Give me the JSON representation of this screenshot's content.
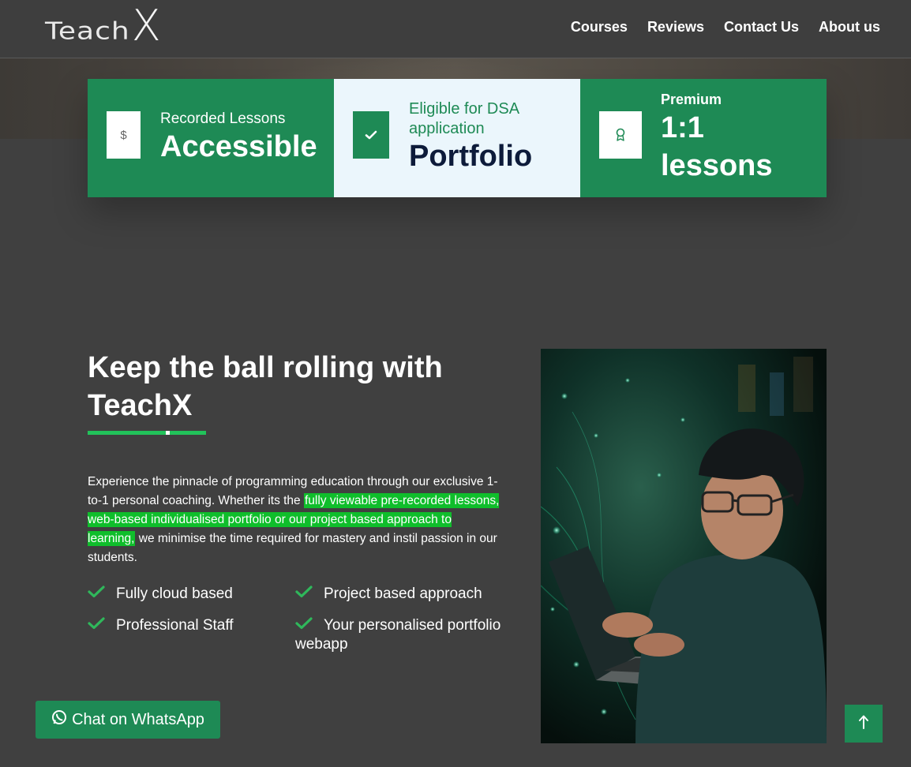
{
  "header": {
    "logo_teach": "Teach",
    "logo_x": "X",
    "nav": [
      "Courses",
      "Reviews",
      "Contact Us",
      "About us"
    ]
  },
  "cards": [
    {
      "small": "Recorded Lessons",
      "big": "Accessible",
      "icon": "dollar-icon",
      "icon_glyph": "$"
    },
    {
      "small": "Eligible for DSA application",
      "big": "Portfolio",
      "icon": "check-icon"
    },
    {
      "small": "Premium",
      "big": "1:1 lessons",
      "icon": "award-icon"
    }
  ],
  "main": {
    "headline": "Keep the ball rolling with TeachX",
    "intro_before": "Experience the pinnacle of programming education through our exclusive 1-to-1 personal coaching. Whether its the ",
    "intro_highlight": "fully viewable pre-recorded lessons, web-based individualised portfolio or our project based approach to learning,",
    "intro_after": " we minimise the time required for mastery and instil passion in our students.",
    "features": [
      "Fully cloud based",
      "Project based approach",
      "Professional Staff",
      "Your personalised portfolio webapp"
    ]
  },
  "floating": {
    "whatsapp_label": "Chat on WhatsApp",
    "back_to_top_icon": "arrow-up-icon"
  },
  "colors": {
    "brand_green": "#1e8a55",
    "highlight_green": "#0fbe2b",
    "card_light": "#ebf6fc",
    "navy_text": "#0d1b3a",
    "page_bg": "#404040"
  }
}
